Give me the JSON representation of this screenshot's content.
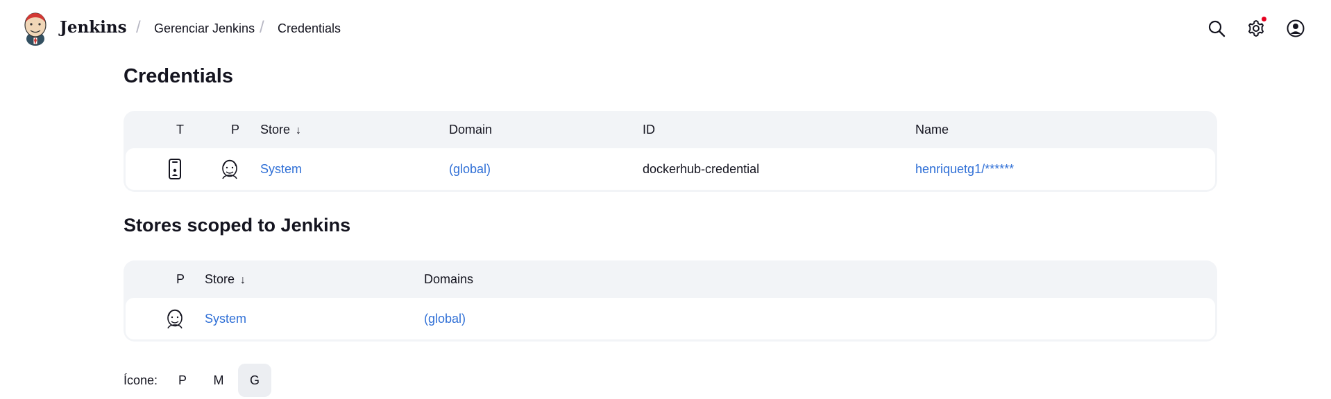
{
  "header": {
    "brand": "Jenkins",
    "breadcrumbs": [
      "Gerenciar Jenkins",
      "Credentials"
    ],
    "icons": [
      "search-icon",
      "settings-icon",
      "user-icon"
    ],
    "notification_color": "#e6001f"
  },
  "credentials": {
    "title": "Credentials",
    "columns": {
      "t": "T",
      "p": "P",
      "store": "Store",
      "domain": "Domain",
      "id": "ID",
      "name": "Name"
    },
    "sort_indicator": "↓",
    "rows": [
      {
        "store": "System",
        "domain": "(global)",
        "id": "dockerhub-credential",
        "name": "henriquetg1/******"
      }
    ]
  },
  "stores": {
    "title": "Stores scoped to Jenkins",
    "columns": {
      "p": "P",
      "store": "Store",
      "domains": "Domains"
    },
    "sort_indicator": "↓",
    "rows": [
      {
        "store": "System",
        "domains": "(global)"
      }
    ]
  },
  "icon_size": {
    "label": "Ícone:",
    "options": [
      "P",
      "M",
      "G"
    ],
    "selected": "G"
  },
  "colors": {
    "link": "#2f6fd6",
    "table_bg": "#f2f4f7"
  }
}
